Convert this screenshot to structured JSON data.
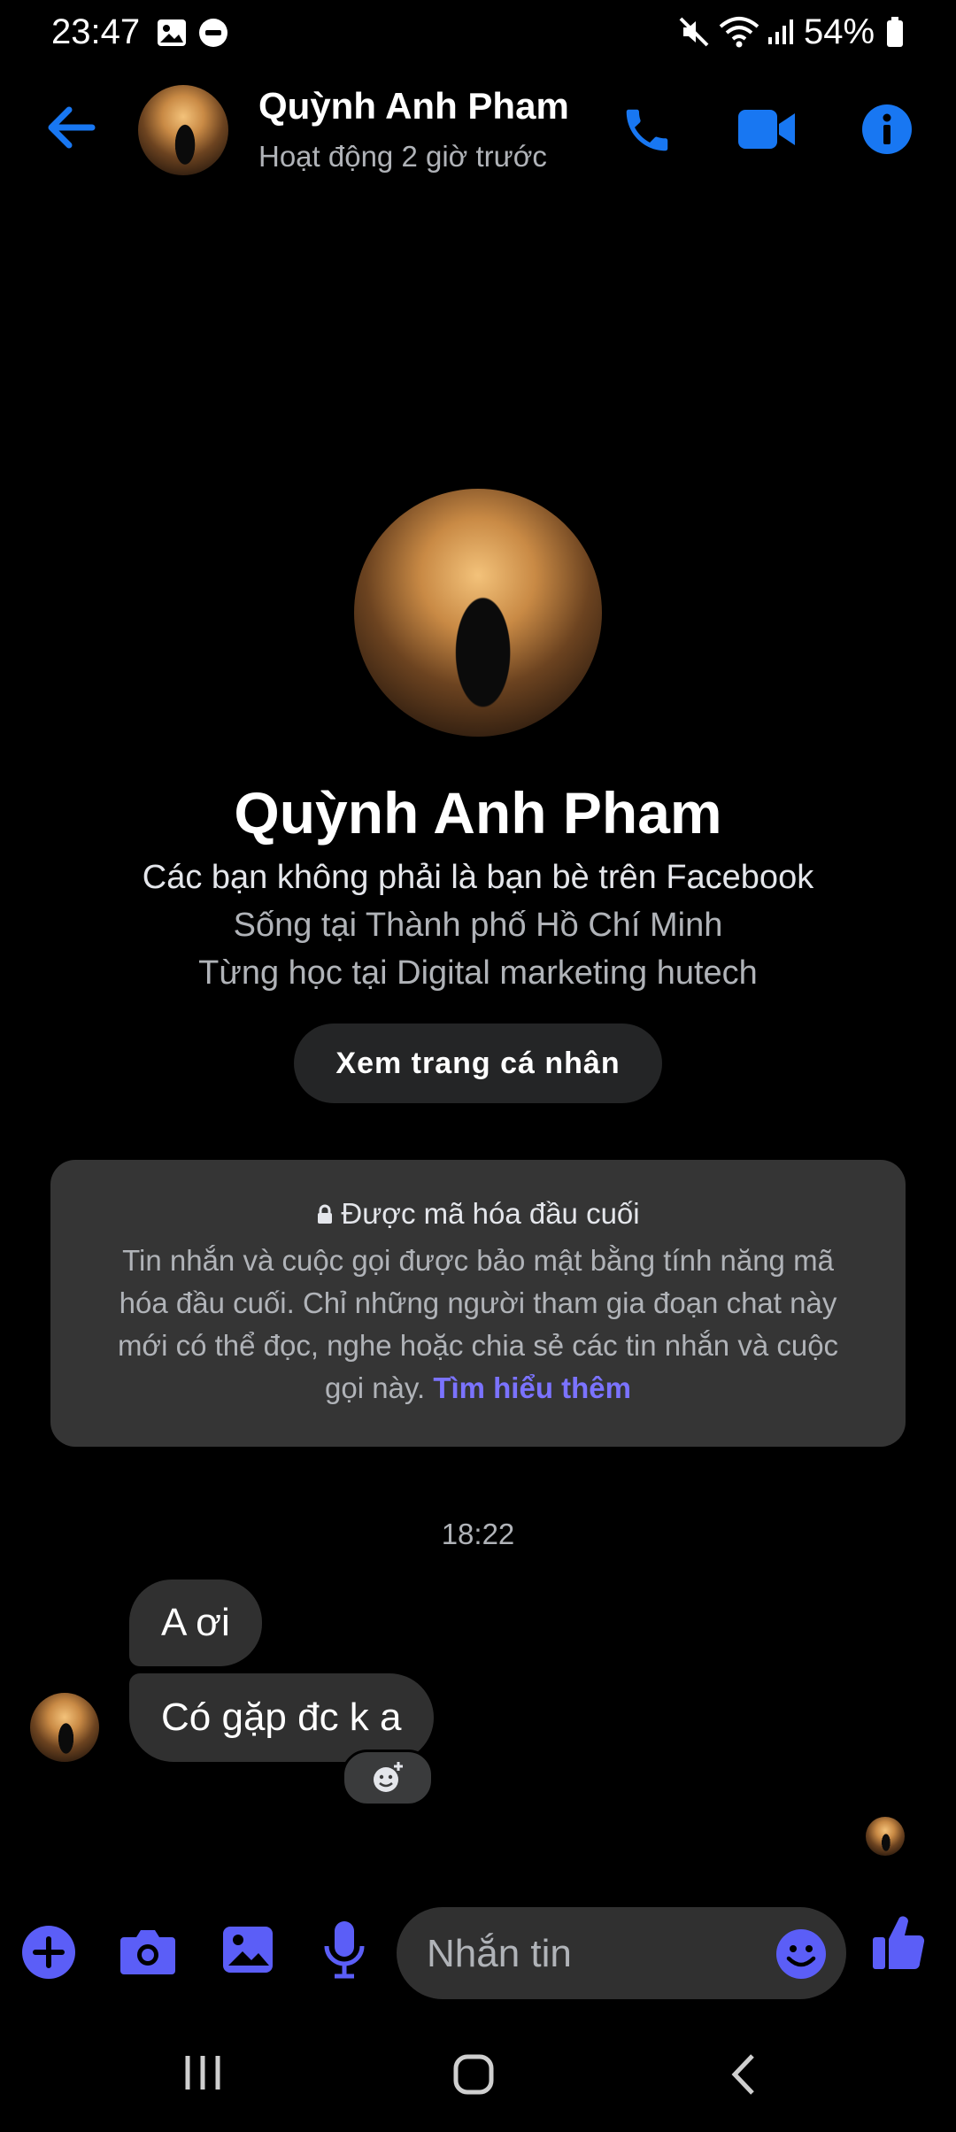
{
  "status_bar": {
    "time": "23:47",
    "battery": "54%",
    "icons": [
      "image-icon",
      "dnd-icon",
      "mute-icon",
      "wifi-icon",
      "signal-icon",
      "battery-icon"
    ]
  },
  "header": {
    "contact_name": "Quỳnh Anh Pham",
    "activity": "Hoạt động 2 giờ trước",
    "icons": [
      "back-arrow-icon",
      "phone-icon",
      "video-icon",
      "info-icon"
    ]
  },
  "profile": {
    "name": "Quỳnh Anh Pham",
    "friend_status": "Các bạn không phải là bạn bè trên Facebook",
    "location": "Sống tại Thành phố Hồ Chí Minh",
    "education": "Từng học tại Digital marketing hutech",
    "view_profile_label": "Xem trang cá nhân"
  },
  "encryption": {
    "title": "Được mã hóa đầu cuối",
    "body": "Tin nhắn và cuộc gọi được bảo mật bằng tính năng mã hóa đầu cuối. Chỉ những người tham gia đoạn chat này mới có thể đọc, nghe hoặc chia sẻ các tin nhắn và cuộc gọi này.",
    "link": "Tìm hiểu thêm"
  },
  "messages": {
    "timestamp": "18:22",
    "items": [
      {
        "text": "A ơi"
      },
      {
        "text": "Có gặp đc k a"
      }
    ]
  },
  "composer": {
    "placeholder": "Nhắn tin",
    "icons": [
      "plus-icon",
      "camera-icon",
      "gallery-icon",
      "mic-icon",
      "emoji-icon",
      "like-icon"
    ]
  },
  "colors": {
    "accent": "#1877f2",
    "composer_accent": "#5b5ef7",
    "link": "#7b73ff",
    "bubble": "#303030",
    "card": "#353535"
  }
}
